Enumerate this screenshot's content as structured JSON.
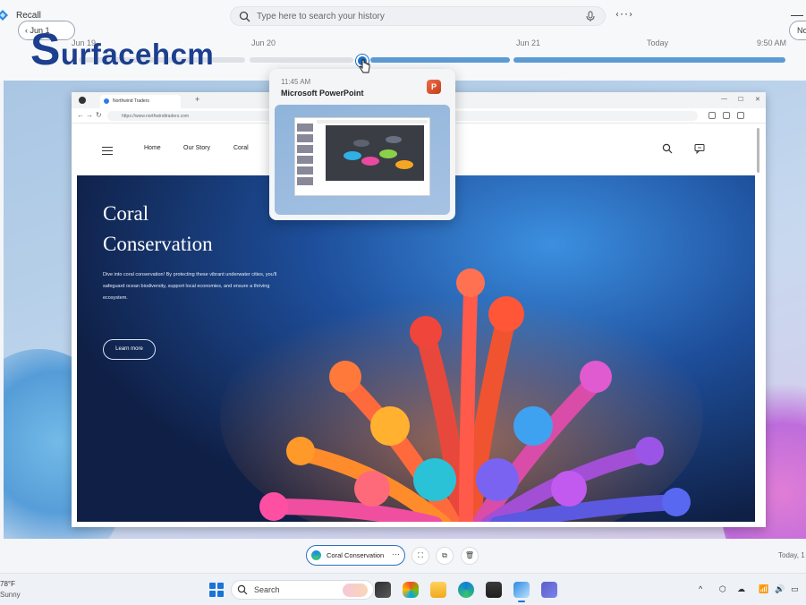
{
  "recall": {
    "app_title": "Recall",
    "search_placeholder": "Type here to search your history",
    "code_icon_text": "‹··›",
    "minimize_glyph": "—"
  },
  "timeline": {
    "dates": [
      "Jun 19",
      "Jun 20",
      "Jun 21",
      "Today",
      "9:50 AM"
    ],
    "prev_button": "Jun 1",
    "next_button": "No"
  },
  "watermark": {
    "first_letter": "S",
    "rest": "urfacehcm",
    "color": "#1c3f8f"
  },
  "hover_card": {
    "time": "11:45 AM",
    "app_name": "Microsoft PowerPoint",
    "app_icon_letter": "P",
    "app_icon_name": "powerpoint-icon"
  },
  "browser": {
    "tab_title": "Northwind Traders",
    "url": "https://www.northwindtraders.com",
    "new_tab": "+",
    "nav_links": [
      "Home",
      "Our Story",
      "Coral"
    ],
    "hero_title_line1": "Coral",
    "hero_title_line2": "Conservation",
    "hero_description": "Dive into coral conservation! By protecting these vibrant underwater cities, you'll safeguard ocean biodiversity, support local economies, and ensure a thriving ecosystem.",
    "hero_button": "Learn more"
  },
  "actions": {
    "snapshot_label": "Coral Conservation",
    "more_glyph": "···",
    "today_text": "Today, 1"
  },
  "taskbar": {
    "weather_temp": "78°F",
    "weather_desc": "Sunny",
    "search_label": "Search",
    "tray_chevron": "^"
  },
  "colors": {
    "accent": "#1f6fc4",
    "timeline_blue": "#5b9bd5",
    "powerpoint": "#c43e1c"
  }
}
